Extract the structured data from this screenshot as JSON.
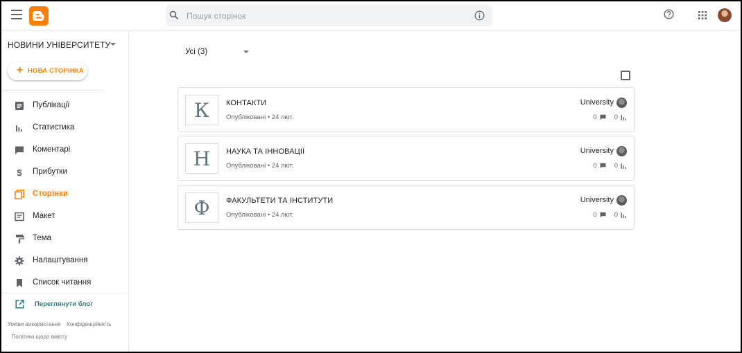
{
  "app": {
    "search_placeholder": "Пошук сторінок"
  },
  "sidebar": {
    "blog_name": "НОВИНИ УНІВЕРСИТЕТУ",
    "new_page_label": "НОВА СТОРІНКА",
    "items": [
      {
        "label": "Публікації",
        "icon": "posts-icon"
      },
      {
        "label": "Статистика",
        "icon": "stats-icon"
      },
      {
        "label": "Коментарі",
        "icon": "comments-icon"
      },
      {
        "label": "Прибутки",
        "icon": "dollar-icon"
      },
      {
        "label": "Сторінки",
        "icon": "pages-icon"
      },
      {
        "label": "Макет",
        "icon": "layout-icon"
      },
      {
        "label": "Тема",
        "icon": "paint-roller-icon"
      },
      {
        "label": "Налаштування",
        "icon": "gear-icon"
      },
      {
        "label": "Список читання",
        "icon": "bookmark-icon"
      }
    ],
    "active_item": "Сторінки",
    "view_blog_label": "Переглянути блог",
    "footer": {
      "terms": "Умови використання",
      "privacy": "Конфіденційність",
      "content_policy": "Політика щодо вмісту"
    }
  },
  "main": {
    "filter_label": "Усі (3)",
    "pages": [
      {
        "thumb_letter": "К",
        "title": "КОНТАКТИ",
        "status": "Опубліковані",
        "date": "24 лют.",
        "author": "University",
        "comments": "0",
        "views": "0"
      },
      {
        "thumb_letter": "Н",
        "title": "НАУКА ТА ІННОВАЦІЇ",
        "status": "Опубліковані",
        "date": "24 лют.",
        "author": "University",
        "comments": "0",
        "views": "0"
      },
      {
        "thumb_letter": "Ф",
        "title": "ФАКУЛЬТЕТИ ТА ІНСТИТУТИ",
        "status": "Опубліковані",
        "date": "24 лют.",
        "author": "University",
        "comments": "0",
        "views": "0"
      }
    ]
  },
  "colors": {
    "accent": "#ff8000",
    "link": "#1e7f8c"
  }
}
